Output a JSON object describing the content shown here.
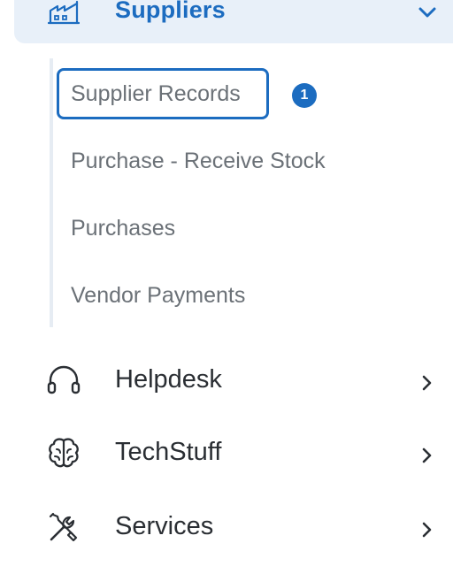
{
  "sections": {
    "suppliers": {
      "label": "Suppliers",
      "icon": "warehouse-icon",
      "expanded": true,
      "accent": "#1c6cc0",
      "submenu": [
        {
          "label": "Supplier Records",
          "focused": true,
          "badge": "1"
        },
        {
          "label": "Purchase - Receive Stock"
        },
        {
          "label": "Purchases"
        },
        {
          "label": "Vendor Payments"
        }
      ]
    },
    "helpdesk": {
      "label": "Helpdesk",
      "icon": "headphones-icon"
    },
    "techstuff": {
      "label": "TechStuff",
      "icon": "brain-icon"
    },
    "services": {
      "label": "Services",
      "icon": "tools-icon"
    }
  }
}
